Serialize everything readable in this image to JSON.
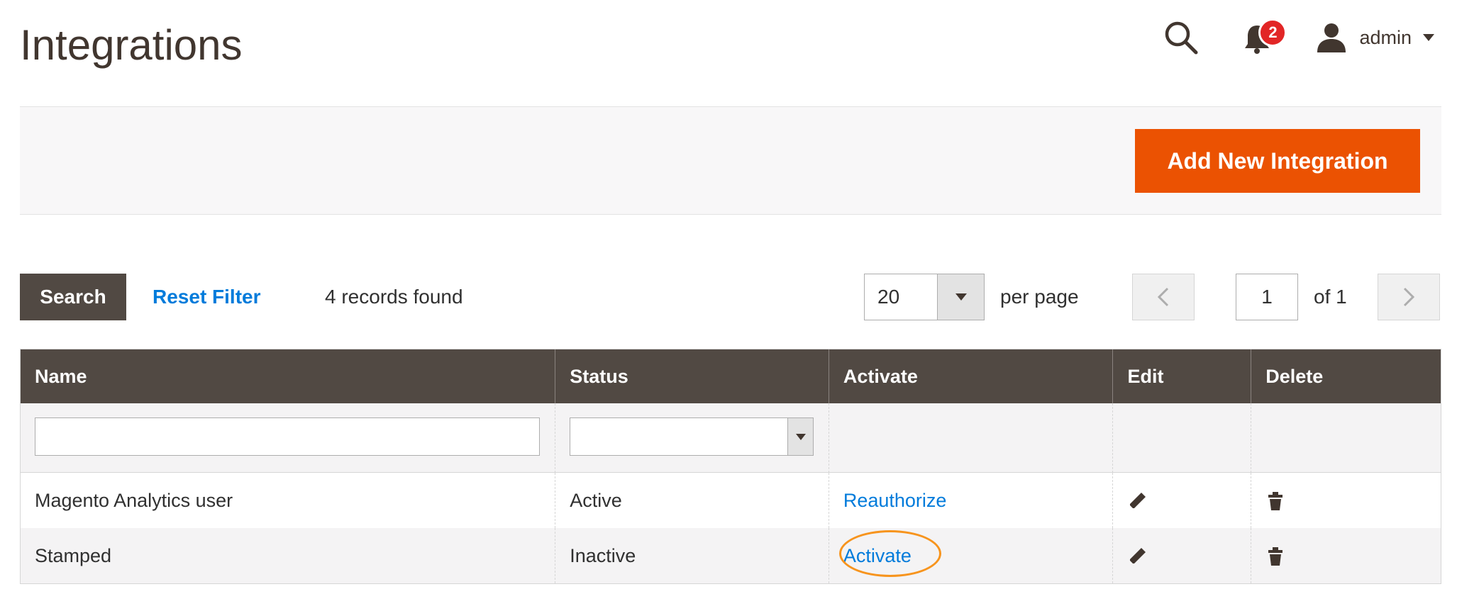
{
  "page": {
    "title": "Integrations"
  },
  "header": {
    "notification_count": "2",
    "user_name": "admin",
    "icons": [
      "search-icon",
      "bell-icon",
      "user-icon",
      "chevron-down-icon"
    ]
  },
  "actions": {
    "add_button": "Add New Integration"
  },
  "toolbar": {
    "search_label": "Search",
    "reset_label": "Reset Filter",
    "records": "4 records found",
    "per_page_value": "20",
    "per_page_label": "per page",
    "current_page": "1",
    "of_pages": "of 1"
  },
  "table": {
    "columns": [
      "Name",
      "Status",
      "Activate",
      "Edit",
      "Delete"
    ],
    "rows": [
      {
        "name": "Magento Analytics user",
        "status": "Active",
        "activate": "Reauthorize"
      },
      {
        "name": "Stamped",
        "status": "Inactive",
        "activate": "Activate"
      }
    ]
  },
  "colors": {
    "accent": "#eb5202",
    "link": "#007bdb",
    "header_dark": "#514943",
    "highlight": "#f7941d",
    "badge": "#e22626"
  }
}
